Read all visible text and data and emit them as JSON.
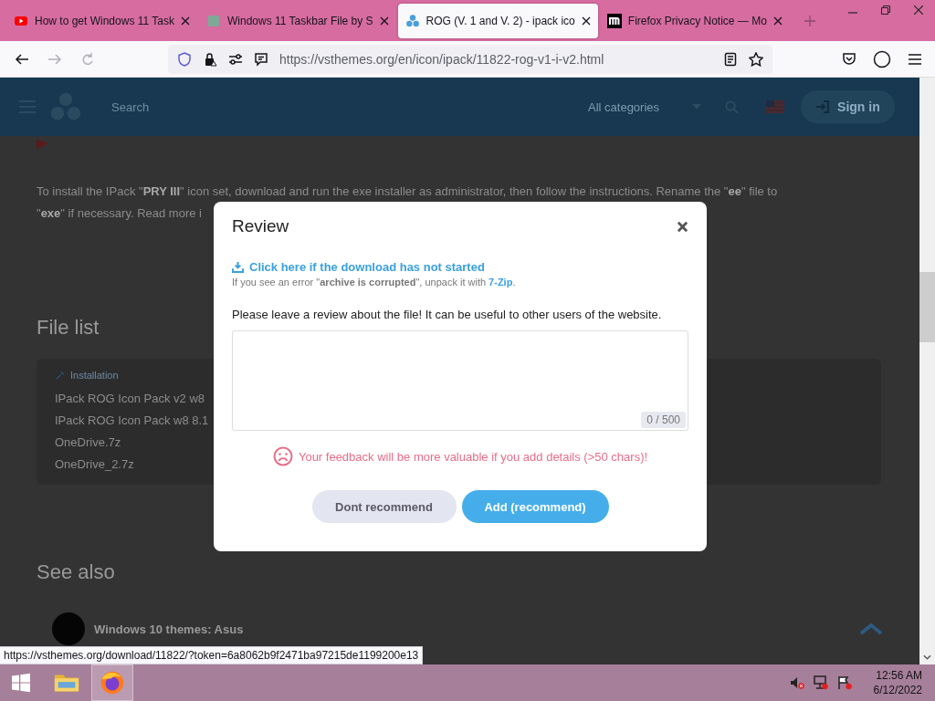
{
  "browser": {
    "tabs": [
      {
        "title": "How to get Windows 11 Task",
        "kind": "video",
        "selected": false
      },
      {
        "title": "Windows 11 Taskbar File by S",
        "kind": "square",
        "selected": false
      },
      {
        "title": "ROG (V. 1 and V. 2) - ipack ico",
        "kind": "dots",
        "selected": true
      },
      {
        "title": "Firefox Privacy Notice — Mo",
        "kind": "letter",
        "selected": false
      }
    ],
    "address": "https://vsthemes.org/en/icon/ipack/11822-rog-v1-i-v2.html"
  },
  "site_header": {
    "search_placeholder": "Search",
    "category": "All categories",
    "sign_in": "Sign in"
  },
  "page": {
    "install_text": [
      "To install the IPack \"**PRY III**\" icon set, download and run the exe installer as administrator, then follow the instructions. Rename the \"**ee**\" file to",
      "\"**exe**\" if necessary. Read more i"
    ],
    "file_list": {
      "heading": "File list",
      "section": "Installation",
      "files": [
        "IPack ROG Icon Pack v2 w8",
        "IPack ROG Icon Pack w8 8.1",
        "OneDrive.7z",
        "OneDrive_2.7z"
      ]
    },
    "see_also": {
      "heading": "See also",
      "items": [
        "Windows 10 themes: Asus"
      ]
    }
  },
  "dialog": {
    "title": "Review",
    "download_link": "Click here if the download has not started",
    "hint": {
      "text": "If you see an error \"**archive is corrupted**\", unpack it with",
      "link": "7-Zip",
      "after": "."
    },
    "prompt": "Please leave a review about the file! It can be useful to other users of the website.",
    "counter": "0 / 500",
    "warning": "Your feedback will be more valuable if you add details (>50 chars)!",
    "buttons": [
      {
        "label": "Dont recommend",
        "kind": "secondary"
      },
      {
        "label": "Add (recommend)",
        "kind": "primary"
      }
    ]
  },
  "status_url": "https://vsthemes.org/download/11822/?token=6a8062b9f2471ba97215de1199200e13",
  "taskbar": {
    "apps": [
      {
        "kind": "folder",
        "selected": false
      },
      {
        "kind": "browser",
        "selected": true
      }
    ],
    "time": "12:56 AM",
    "date": "6/12/2022"
  }
}
